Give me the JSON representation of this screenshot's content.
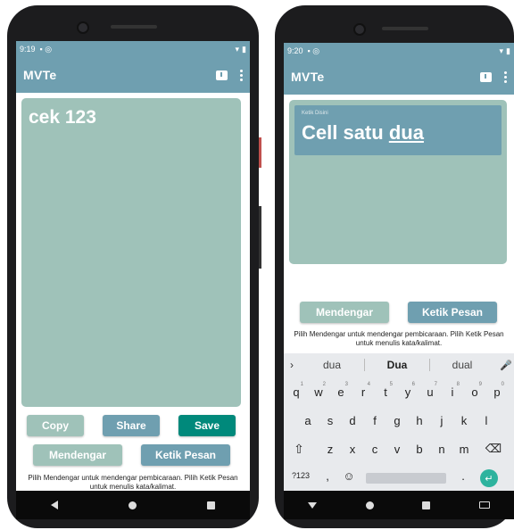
{
  "left_phone": {
    "status": {
      "time": "9:19"
    },
    "appbar": {
      "title": "MVTe"
    },
    "content_text": "cek 123",
    "buttons": {
      "copy": "Copy",
      "share": "Share",
      "save": "Save",
      "listen": "Mendengar",
      "type": "Ketik Pesan"
    },
    "hint": "Pilih Mendengar untuk mendengar pembicaraan. Pilih Ketik Pesan untuk menulis kata/kalimat."
  },
  "right_phone": {
    "status": {
      "time": "9:20"
    },
    "appbar": {
      "title": "MVTe"
    },
    "input": {
      "label": "Ketik Disini",
      "value_prefix": "Cell satu ",
      "value_underlined": "dua"
    },
    "buttons": {
      "listen": "Mendengar",
      "type": "Ketik Pesan"
    },
    "hint": "Pilih Mendengar untuk mendengar pembicaraan. Pilih Ketik Pesan untuk menulis kata/kalimat.",
    "keyboard": {
      "suggestions": [
        "dua",
        "Dua",
        "dual"
      ],
      "row1": [
        "q",
        "w",
        "e",
        "r",
        "t",
        "y",
        "u",
        "i",
        "o",
        "p"
      ],
      "row1_nums": [
        "1",
        "2",
        "3",
        "4",
        "5",
        "6",
        "7",
        "8",
        "9",
        "0"
      ],
      "row2": [
        "a",
        "s",
        "d",
        "f",
        "g",
        "h",
        "j",
        "k",
        "l"
      ],
      "row3": [
        "z",
        "x",
        "c",
        "v",
        "b",
        "n",
        "m"
      ],
      "symbols_key": "?123",
      "comma": ",",
      "period": "."
    }
  },
  "colors": {
    "primary": "#6f9fb0",
    "panel": "#9fc2b9",
    "teal": "#00897b",
    "enter": "#2db39e"
  }
}
